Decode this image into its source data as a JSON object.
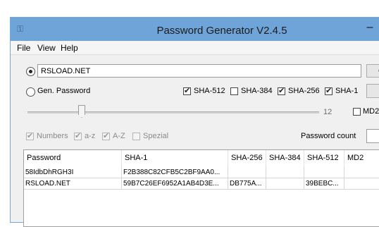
{
  "window": {
    "title": "Password Generator V2.4.5",
    "minimize_glyph": "–"
  },
  "menu": [
    "File",
    "View",
    "Help"
  ],
  "source": {
    "custom_text": "RSLOAD.NET",
    "gen_password_label": "Gen. Password",
    "selected": "custom"
  },
  "hashes": [
    {
      "label": "SHA-512",
      "checked": true
    },
    {
      "label": "SHA-384",
      "checked": false
    },
    {
      "label": "SHA-256",
      "checked": true
    },
    {
      "label": "SHA-1",
      "checked": true
    },
    {
      "label": "MD2",
      "checked": false
    }
  ],
  "length": {
    "value": "12",
    "fraction": 0.17
  },
  "charsets": [
    {
      "label": "Numbers",
      "checked": true
    },
    {
      "label": "a-z",
      "checked": true
    },
    {
      "label": "A-Z",
      "checked": true
    },
    {
      "label": "Spezial",
      "checked": false
    }
  ],
  "password_count_label": "Password count",
  "table": {
    "columns": [
      "Password",
      "SHA-1",
      "SHA-256",
      "SHA-384",
      "SHA-512",
      "MD2"
    ],
    "rows": [
      [
        "58IdbDhRGH3I",
        "F2B388C82CFB5C2BF9AA0...",
        "",
        "",
        "",
        ""
      ],
      [
        "RSLOAD.NET",
        "59B7C26EF6952A1AB4D3E...",
        "DB775A...",
        "",
        "39BEBC...",
        ""
      ]
    ]
  }
}
